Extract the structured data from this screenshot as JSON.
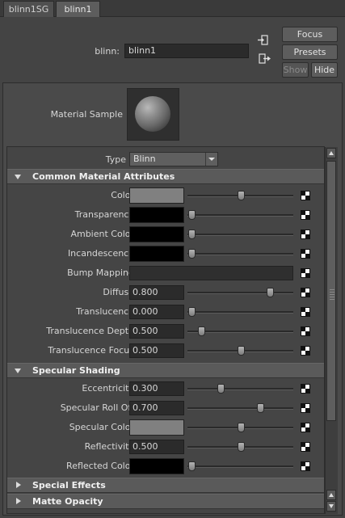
{
  "tabs": [
    {
      "label": "blinn1SG",
      "active": false
    },
    {
      "label": "blinn1",
      "active": true
    }
  ],
  "header": {
    "name_label": "blinn:",
    "name_value": "blinn1",
    "buttons": {
      "focus": "Focus",
      "presets": "Presets",
      "show": "Show",
      "hide": "Hide"
    }
  },
  "sample": {
    "label": "Material Sample"
  },
  "type_field": {
    "label": "Type",
    "value": "Blinn"
  },
  "sections": {
    "common": {
      "title": "Common Material Attributes",
      "expanded": true
    },
    "specular": {
      "title": "Specular Shading",
      "expanded": true
    },
    "special": {
      "title": "Special Effects",
      "expanded": false
    },
    "matte": {
      "title": "Matte Opacity",
      "expanded": false
    }
  },
  "common_rows": [
    {
      "label": "Color",
      "kind": "color",
      "color": "#808080",
      "slider": 0.5
    },
    {
      "label": "Transparency",
      "kind": "color",
      "color": "#000000",
      "slider": 0.0
    },
    {
      "label": "Ambient Color",
      "kind": "color",
      "color": "#000000",
      "slider": 0.0
    },
    {
      "label": "Incandescence",
      "kind": "color",
      "color": "#000000",
      "slider": 0.0
    },
    {
      "label": "Bump Mapping",
      "kind": "bump"
    },
    {
      "label": "Diffuse",
      "kind": "number",
      "value": "0.800",
      "slider": 0.8
    },
    {
      "label": "Translucence",
      "kind": "number",
      "value": "0.000",
      "slider": 0.0
    },
    {
      "label": "Translucence Depth",
      "kind": "number",
      "value": "0.500",
      "slider": 0.1
    },
    {
      "label": "Translucence Focus",
      "kind": "number",
      "value": "0.500",
      "slider": 0.5
    }
  ],
  "specular_rows": [
    {
      "label": "Eccentricity",
      "kind": "number",
      "value": "0.300",
      "slider": 0.3
    },
    {
      "label": "Specular Roll Off",
      "kind": "number",
      "value": "0.700",
      "slider": 0.7
    },
    {
      "label": "Specular Color",
      "kind": "color",
      "color": "#808080",
      "slider": 0.5
    },
    {
      "label": "Reflectivity",
      "kind": "number",
      "value": "0.500",
      "slider": 0.5
    },
    {
      "label": "Reflected Color",
      "kind": "color",
      "color": "#000000",
      "slider": 0.0
    }
  ]
}
